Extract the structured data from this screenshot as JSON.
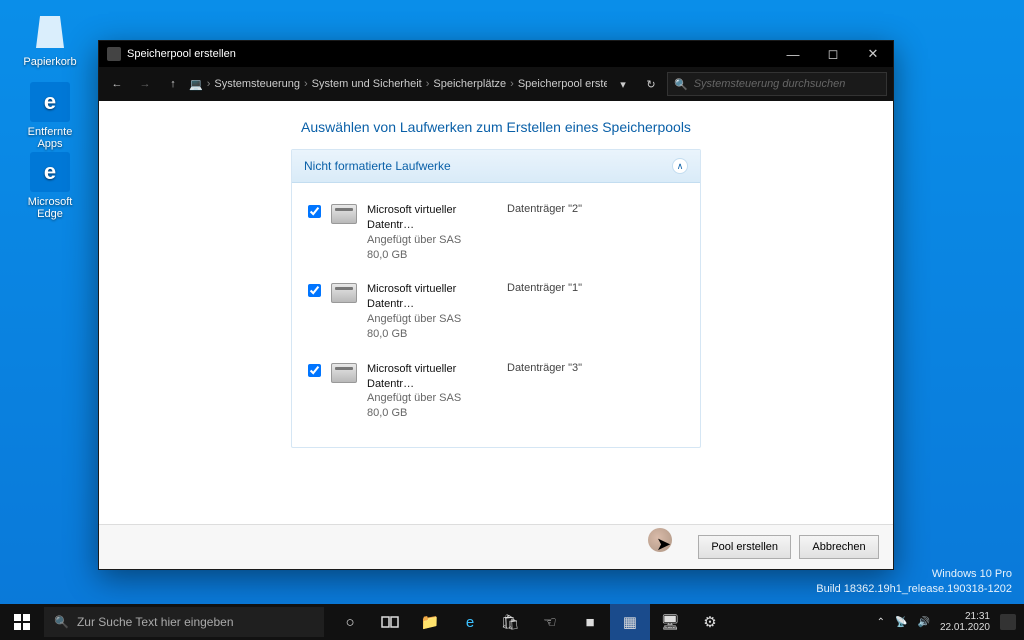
{
  "desktop": {
    "recycle_label": "Papierkorb",
    "apps_label": "Entfernte Apps",
    "edge_label": "Microsoft Edge"
  },
  "watermark": {
    "line1": "Windows 10 Pro",
    "line2": "Build 18362.19h1_release.190318-1202"
  },
  "window": {
    "title": "Speicherpool erstellen",
    "breadcrumb": [
      "Systemsteuerung",
      "System und Sicherheit",
      "Speicherplätze",
      "Speicherpool erstellen"
    ],
    "search_placeholder": "Systemsteuerung durchsuchen",
    "page_title": "Auswählen von Laufwerken zum Erstellen eines Speicherpools",
    "panel_title": "Nicht formatierte Laufwerke",
    "drives": [
      {
        "name": "Microsoft virtueller Datentr…",
        "sub": "Angefügt über SAS",
        "size": "80,0 GB",
        "id": "Datenträger \"2\"",
        "checked": true
      },
      {
        "name": "Microsoft virtueller Datentr…",
        "sub": "Angefügt über SAS",
        "size": "80,0 GB",
        "id": "Datenträger \"1\"",
        "checked": true
      },
      {
        "name": "Microsoft virtueller Datentr…",
        "sub": "Angefügt über SAS",
        "size": "80,0 GB",
        "id": "Datenträger \"3\"",
        "checked": true
      }
    ],
    "create_label": "Pool erstellen",
    "cancel_label": "Abbrechen"
  },
  "taskbar": {
    "search_placeholder": "Zur Suche Text hier eingeben",
    "time": "21:31",
    "date": "22.01.2020"
  }
}
